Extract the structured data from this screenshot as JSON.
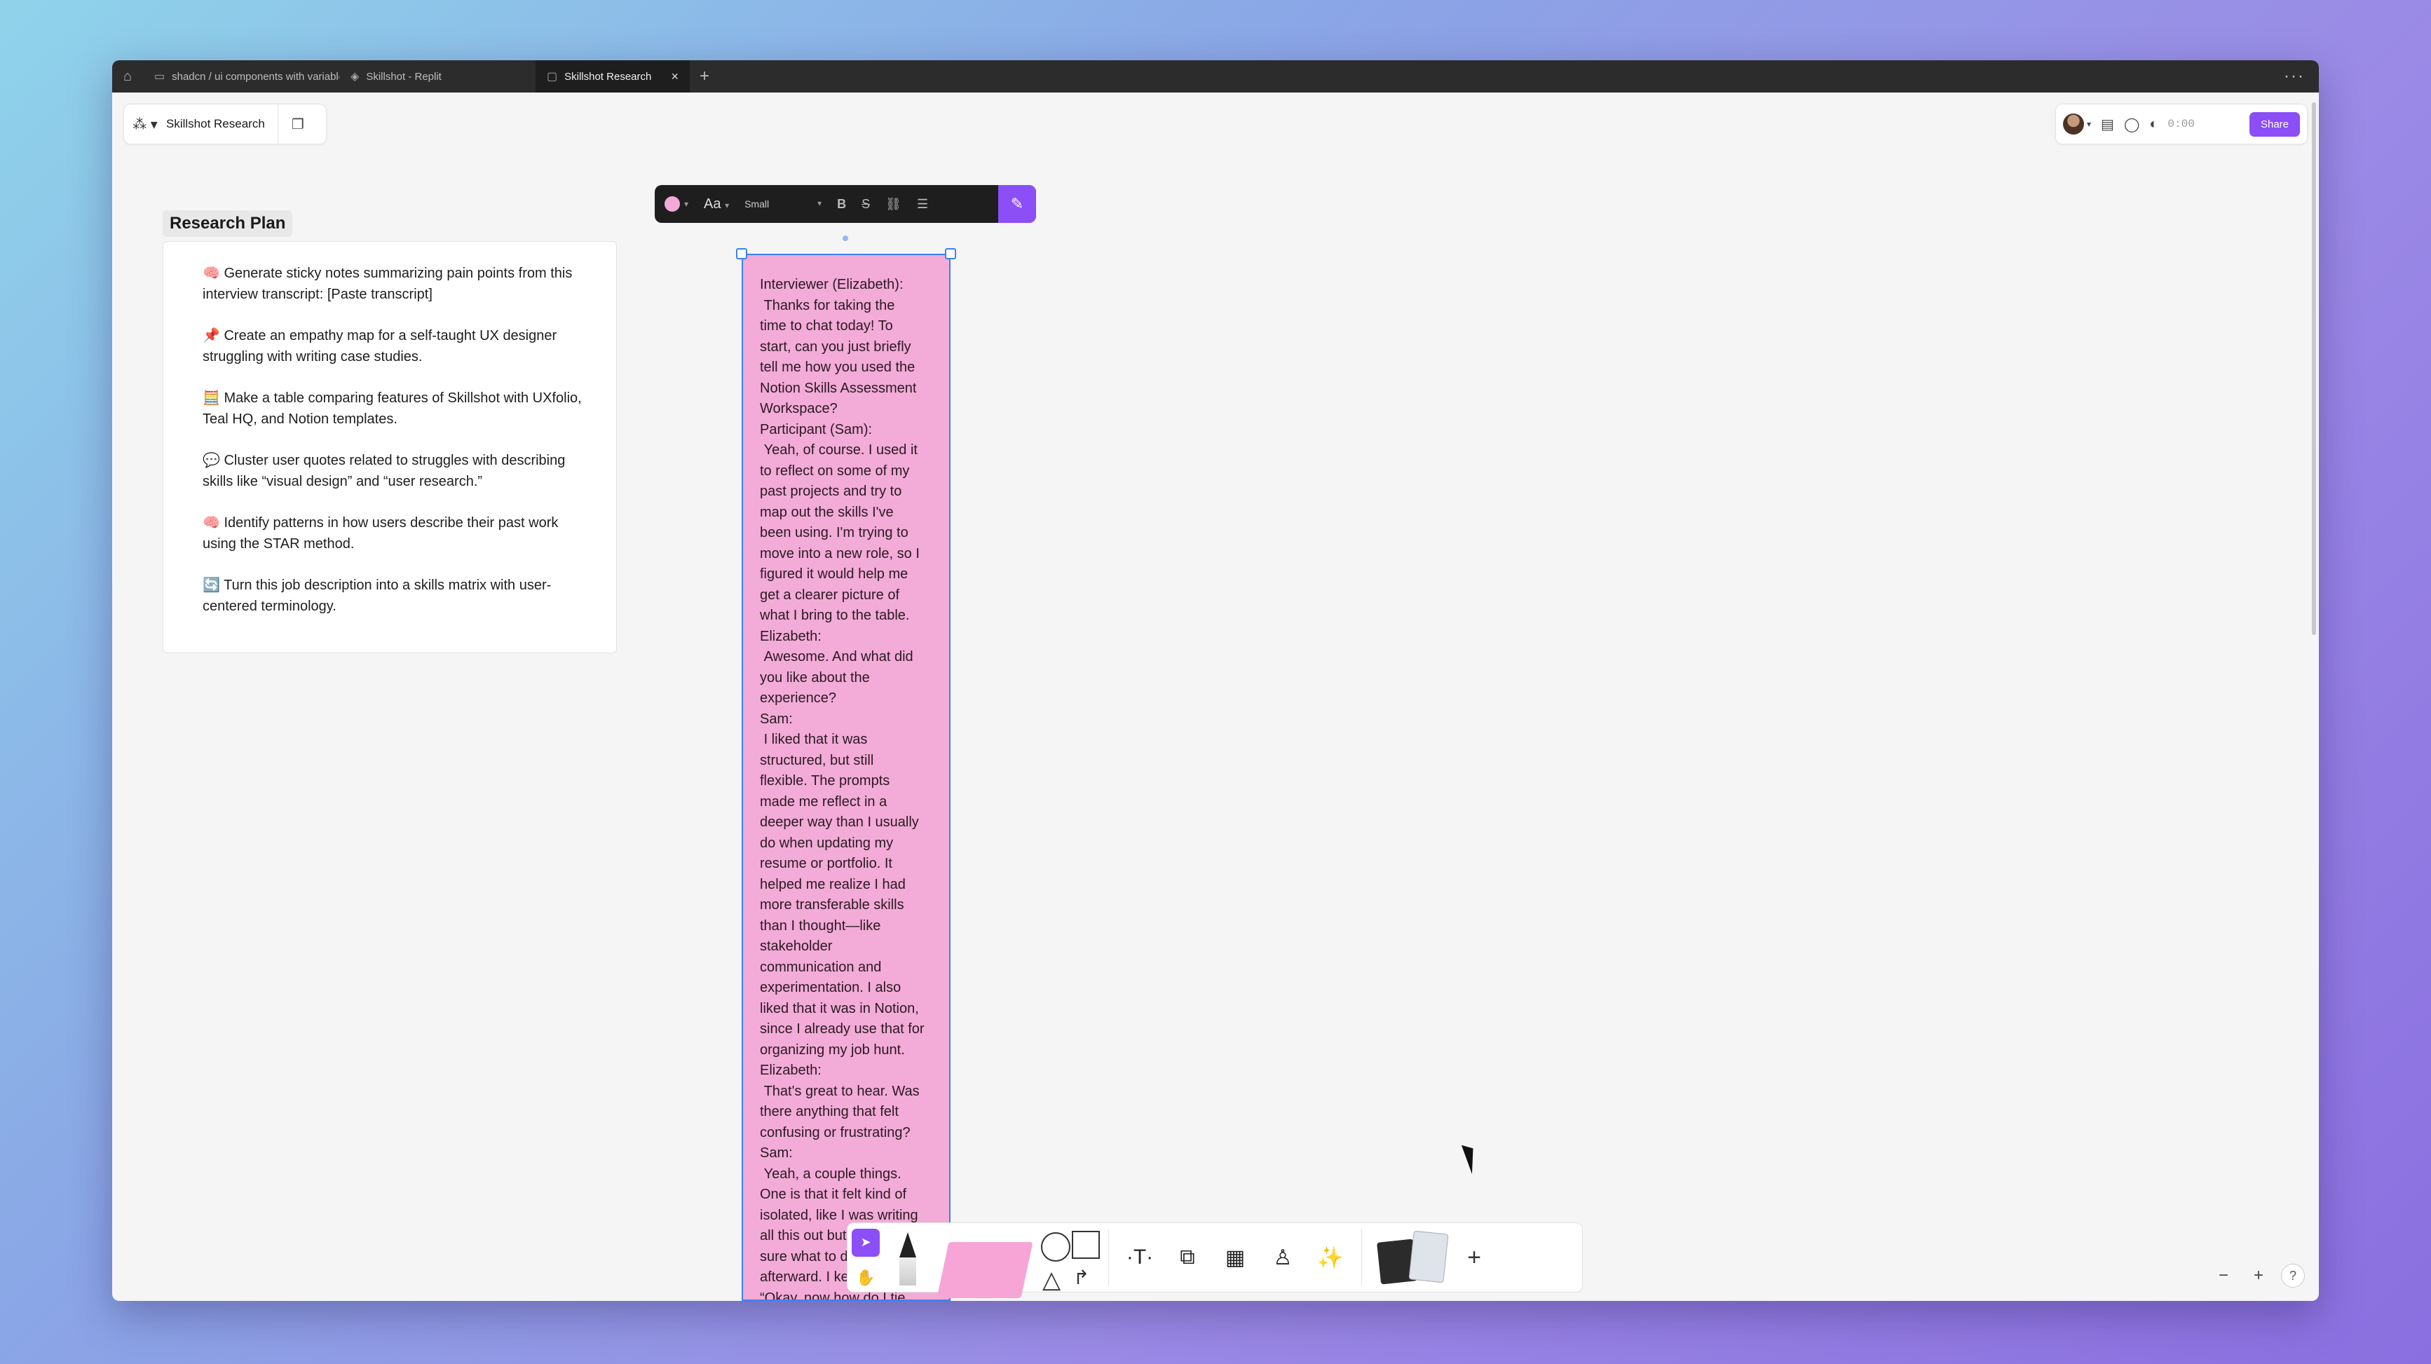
{
  "tabs": [
    {
      "label": "shadcn / ui components with variable",
      "icon": "book-icon"
    },
    {
      "label": "Skillshot - Replit",
      "icon": "replit-icon"
    },
    {
      "label": "Skillshot Research",
      "icon": "figjam-icon",
      "active": true
    }
  ],
  "file": {
    "name": "Skillshot Research"
  },
  "header": {
    "timer": "0:00",
    "share_label": "Share"
  },
  "section": {
    "title": "Research Plan"
  },
  "plan_items": [
    "🧠 Generate sticky notes summarizing pain points from this interview transcript: [Paste transcript]",
    "📌 Create an empathy map for a self-taught UX designer struggling with writing case studies.",
    "🧮 Make a table comparing features of Skillshot with UXfolio, Teal HQ, and Notion templates.",
    "💬 Cluster user quotes related to struggles with describing skills like “visual design” and “user research.”",
    "🧠 Identify patterns in how users describe their past work using the STAR method.",
    "🔄 Turn this job description into a skills matrix with user-centered terminology."
  ],
  "format_toolbar": {
    "font_label": "Aa",
    "size_label": "Small",
    "color": "#f2a9d6"
  },
  "sticky": {
    "color": "#f3abd8",
    "text": "Interviewer (Elizabeth):\n Thanks for taking the\ntime to chat today! To\nstart, can you just briefly\ntell me how you used the\nNotion Skills Assessment\nWorkspace?\nParticipant (Sam):\n Yeah, of course. I used it\nto reflect on some of my\npast projects and try to\nmap out the skills I've\nbeen using. I'm trying to\nmove into a new role, so I\nfigured it would help me\nget a clearer picture of\nwhat I bring to the table.\nElizabeth:\n Awesome. And what did\nyou like about the\nexperience?\nSam:\n I liked that it was\nstructured, but still\nflexible. The prompts\nmade me reflect in a\ndeeper way than I usually\ndo when updating my\nresume or portfolio. It\nhelped me realize I had\nmore transferable skills\nthan I thought—like\nstakeholder\ncommunication and\nexperimentation. I also\nliked that it was in Notion,\nsince I already use that for\norganizing my job hunt.\nElizabeth:\n That's great to hear. Was\nthere anything that felt\nconfusing or frustrating?\nSam:\n Yeah, a couple things.\nOne is that it felt kind of\nisolated, like I was writing\nall this out but wasn't\nsure what to do with it\nafterward. I kept thinking,\n“Okay, now how do I tie"
  },
  "zoom": {
    "minus": "−",
    "plus": "+",
    "help": "?"
  },
  "colors": {
    "accent": "#8b4ef7",
    "selection": "#3b82f6",
    "canvas": "#f5f5f5"
  }
}
